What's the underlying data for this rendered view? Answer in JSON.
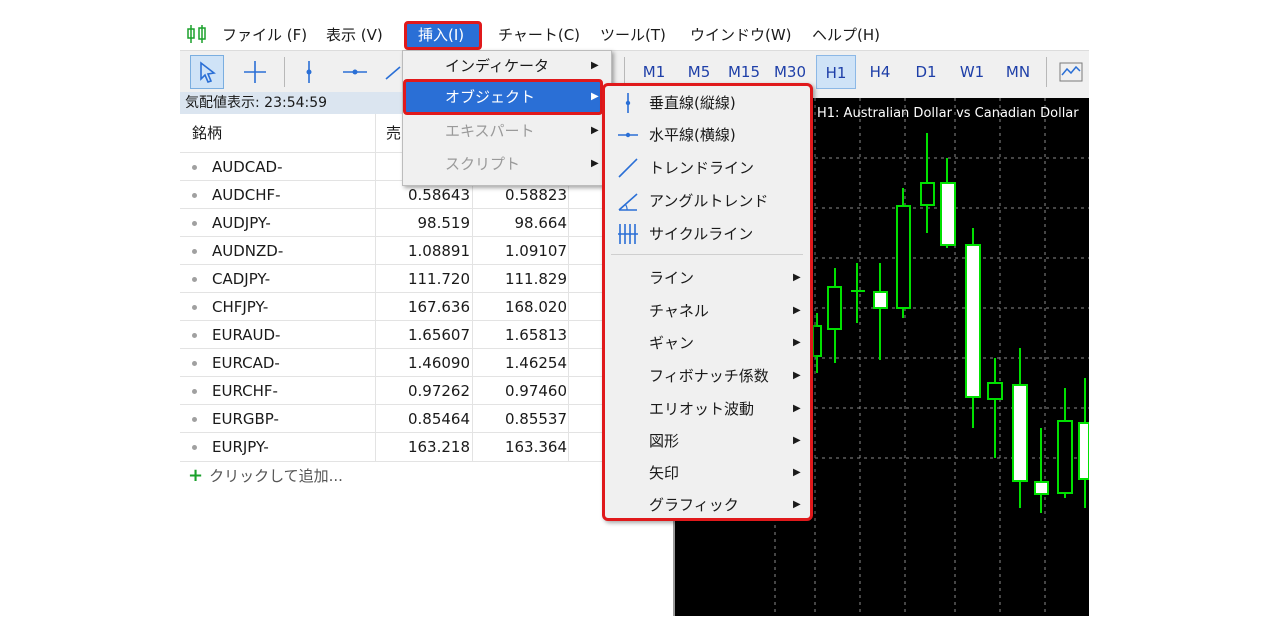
{
  "menubar": {
    "items": [
      "ファイル (F)",
      "表示 (V)",
      "挿入(I)",
      "チャート(C)",
      "ツール(T)",
      "ウインドウ(W)",
      "ヘルプ(H)"
    ]
  },
  "timeframes": [
    "M1",
    "M5",
    "M15",
    "M30",
    "H1",
    "H4",
    "D1",
    "W1",
    "MN"
  ],
  "active_timeframe": "H1",
  "market_watch": {
    "title": "気配値表示: 23:54:59",
    "col_symbol": "銘柄",
    "col_bid": "売",
    "rows": [
      {
        "symbol": "AUDCAD-",
        "bid": "",
        "ask": ""
      },
      {
        "symbol": "AUDCHF-",
        "bid": "0.58643",
        "ask": "0.58823"
      },
      {
        "symbol": "AUDJPY-",
        "bid": "98.519",
        "ask": "98.664"
      },
      {
        "symbol": "AUDNZD-",
        "bid": "1.08891",
        "ask": "1.09107"
      },
      {
        "symbol": "CADJPY-",
        "bid": "111.720",
        "ask": "111.829"
      },
      {
        "symbol": "CHFJPY-",
        "bid": "167.636",
        "ask": "168.020"
      },
      {
        "symbol": "EURAUD-",
        "bid": "1.65607",
        "ask": "1.65813"
      },
      {
        "symbol": "EURCAD-",
        "bid": "1.46090",
        "ask": "1.46254"
      },
      {
        "symbol": "EURCHF-",
        "bid": "0.97262",
        "ask": "0.97460"
      },
      {
        "symbol": "EURGBP-",
        "bid": "0.85464",
        "ask": "0.85537"
      },
      {
        "symbol": "EURJPY-",
        "bid": "163.218",
        "ask": "163.364"
      }
    ],
    "add_label": "クリックして追加..."
  },
  "chart": {
    "title": "H1:  Australian Dollar vs Canadian Dollar"
  },
  "insert_menu": {
    "items": [
      {
        "label": "インディケータ",
        "enabled": true
      },
      {
        "label": "オブジェクト",
        "enabled": true,
        "highlighted": true
      },
      {
        "label": "エキスパート",
        "enabled": false
      },
      {
        "label": "スクリプト",
        "enabled": false
      }
    ]
  },
  "objects_menu": {
    "items": [
      {
        "label": "垂直線(縦線)",
        "icon": "vertical-line-icon"
      },
      {
        "label": "水平線(横線)",
        "icon": "horizontal-line-icon"
      },
      {
        "label": "トレンドライン",
        "icon": "trendline-icon"
      },
      {
        "label": "アングルトレンド",
        "icon": "angle-trend-icon"
      },
      {
        "label": "サイクルライン",
        "icon": "cycle-lines-icon"
      }
    ],
    "submenus": [
      "ライン",
      "チャネル",
      "ギャン",
      "フィボナッチ係数",
      "エリオット波動",
      "図形",
      "矢印",
      "グラフィック"
    ]
  }
}
